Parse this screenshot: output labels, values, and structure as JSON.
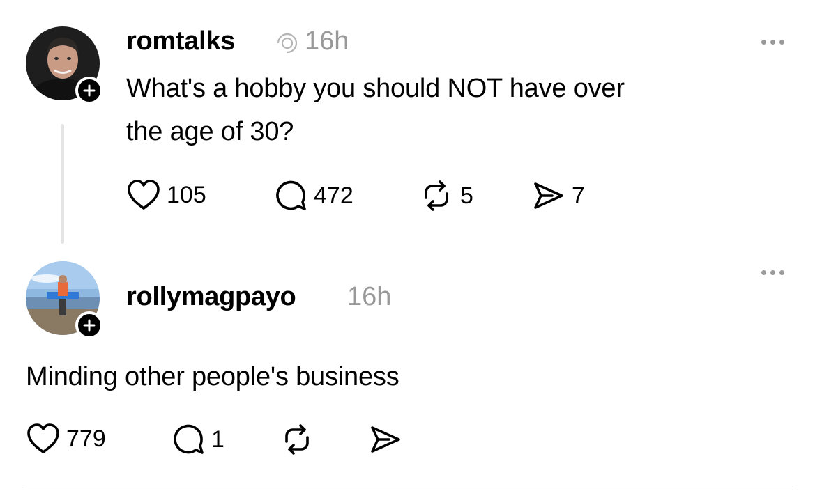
{
  "post": {
    "username": "romtalks",
    "time": "16h",
    "text_line1": "What's a hobby you should NOT have over",
    "text_line2": "the age of 30?",
    "stats": {
      "likes": "105",
      "replies": "472",
      "reposts": "5",
      "shares": "7"
    }
  },
  "reply": {
    "username": "rollymagpayo",
    "time": "16h",
    "text": "Minding other people's business",
    "stats": {
      "likes": "779",
      "replies": "1"
    }
  },
  "icons": {
    "like": "heart-icon",
    "reply": "comment-bubble-icon",
    "repost": "repost-icon",
    "share": "send-icon",
    "follow": "plus-icon",
    "more": "more-dots-icon",
    "verified": "threads-verified-icon"
  },
  "colors": {
    "text": "#000000",
    "muted": "#999999",
    "thread_line": "#e4e4e4"
  }
}
